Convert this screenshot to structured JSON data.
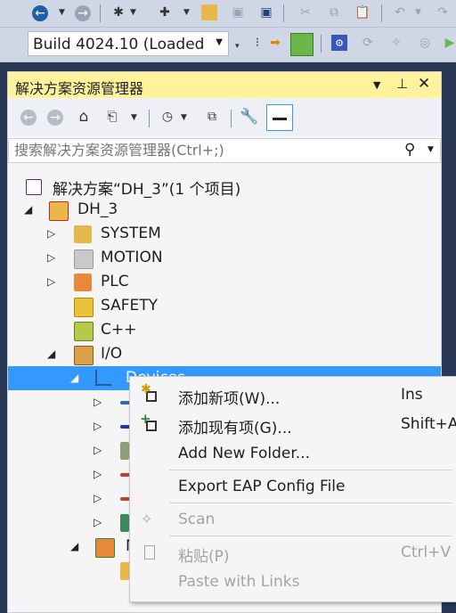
{
  "toolbar": {
    "build_config": "Build 4024.10 (Loaded"
  },
  "solution_explorer": {
    "title": "解决方案资源管理器",
    "search_placeholder": "搜索解决方案资源管理器(Ctrl+;)",
    "tree": [
      {
        "label": "解决方案“DH_3”(1 个项目)",
        "icon": "solution-icon"
      },
      {
        "label": "DH_3",
        "icon": "project-icon"
      },
      {
        "label": "SYSTEM",
        "icon": "system-icon"
      },
      {
        "label": "MOTION",
        "icon": "motion-icon"
      },
      {
        "label": "PLC",
        "icon": "plc-icon"
      },
      {
        "label": "SAFETY",
        "icon": "safety-icon"
      },
      {
        "label": "C++",
        "icon": "cpp-icon"
      },
      {
        "label": "I/O",
        "icon": "io-icon"
      },
      {
        "label": "Devices",
        "icon": "devices-icon"
      },
      {
        "label": "M",
        "icon": "mappings-icon"
      }
    ]
  },
  "context_menu": {
    "items": [
      {
        "label": "添加新项(W)...",
        "shortcut": "Ins",
        "enabled": true,
        "icon": "add-new-item-icon"
      },
      {
        "label": "添加现有项(G)...",
        "shortcut": "Shift+A",
        "enabled": true,
        "icon": "add-existing-item-icon"
      },
      {
        "label": "Add New Folder...",
        "shortcut": "",
        "enabled": true
      },
      {
        "label": "Export EAP Config File",
        "shortcut": "",
        "enabled": true
      },
      {
        "label": "Scan",
        "shortcut": "",
        "enabled": false,
        "icon": "scan-wand-icon"
      },
      {
        "label": "粘贴(P)",
        "shortcut": "Ctrl+V",
        "enabled": false,
        "icon": "paste-icon"
      },
      {
        "label": "Paste with Links",
        "shortcut": "",
        "enabled": false
      }
    ]
  },
  "colors": {
    "accent": "#3399ff",
    "panel_header": "#fff29d",
    "chrome": "#cfd6e5"
  }
}
